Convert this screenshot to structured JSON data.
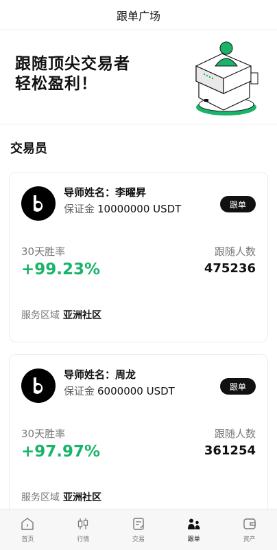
{
  "header": {
    "title": "跟单广场"
  },
  "banner": {
    "line1": "跟随顶尖交易者",
    "line2": "轻松盈利！"
  },
  "section": {
    "title": "交易员"
  },
  "traders": [
    {
      "name_label": "导师姓名：",
      "name": "李曜昇",
      "deposit_label": "保证金",
      "deposit_value": "10000000 USDT",
      "follow_label": "跟单",
      "winrate_label": "30天胜率",
      "winrate_value": "+99.23%",
      "followers_label": "跟随人数",
      "followers_value": "475236",
      "region_label": "服务区域",
      "region_value": "亚洲社区"
    },
    {
      "name_label": "导师姓名：",
      "name": "周龙",
      "deposit_label": "保证金",
      "deposit_value": "6000000 USDT",
      "follow_label": "跟单",
      "winrate_label": "30天胜率",
      "winrate_value": "+97.97%",
      "followers_label": "跟随人数",
      "followers_value": "361254",
      "region_label": "服务区域",
      "region_value": "亚洲社区"
    }
  ],
  "tabbar": {
    "items": [
      {
        "label": "首页",
        "icon": "home-icon"
      },
      {
        "label": "行情",
        "icon": "candlestick-icon"
      },
      {
        "label": "交易",
        "icon": "trade-icon"
      },
      {
        "label": "跟单",
        "icon": "copy-trade-icon",
        "active": true
      },
      {
        "label": "资产",
        "icon": "wallet-icon"
      }
    ]
  },
  "colors": {
    "accent_green": "#1ab36a",
    "dark": "#111111"
  }
}
